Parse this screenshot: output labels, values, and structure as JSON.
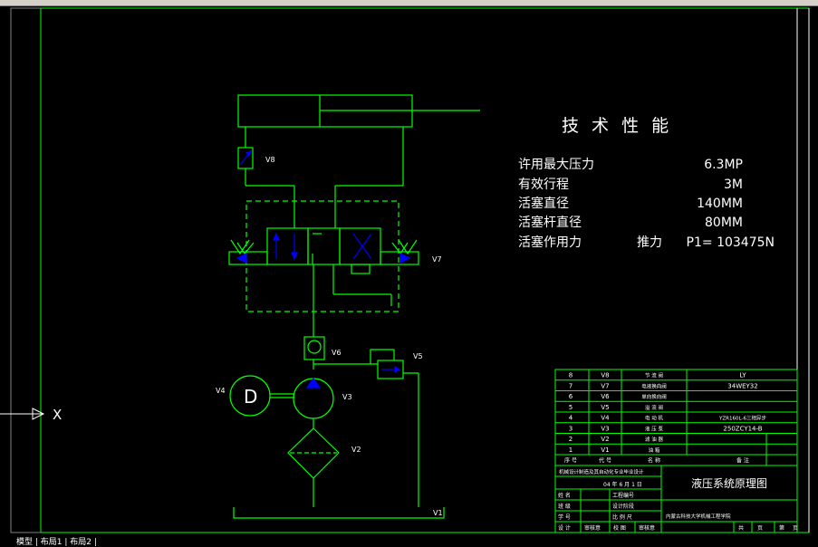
{
  "drawing": {
    "spec_title": "技 术 性 能",
    "specs": [
      {
        "label": "许用最大压力",
        "value": "6.3MP"
      },
      {
        "label": "有效行程",
        "value": "3M"
      },
      {
        "label": "活塞直径",
        "value": "140MM"
      },
      {
        "label": "活塞杆直径",
        "value": "80MM"
      },
      {
        "label": "活塞作用力",
        "extra": "推力",
        "value": "P1= 103475N"
      }
    ],
    "component_labels": {
      "v8": "V8",
      "v7": "V7",
      "v6": "V6",
      "v5": "V5",
      "v4": "V4",
      "v3": "V3",
      "v2": "V2",
      "v1": "V1",
      "motor_letter": "D",
      "ucs_axis": "X"
    },
    "bom_rows": [
      {
        "no": "8",
        "code": "V8",
        "name": "节 流 阀",
        "spec": "LY"
      },
      {
        "no": "7",
        "code": "V7",
        "name": "电液换向阀",
        "spec": "34WEY32"
      },
      {
        "no": "6",
        "code": "V6",
        "name": "单向换向阀",
        "spec": ""
      },
      {
        "no": "5",
        "code": "V5",
        "name": "溢 流 阀",
        "spec": ""
      },
      {
        "no": "4",
        "code": "V4",
        "name": "电 动 机",
        "spec": "YZR160L-6三相异步"
      },
      {
        "no": "3",
        "code": "V3",
        "name": "液 压 泵",
        "spec": "250ZCY14-B"
      },
      {
        "no": "2",
        "code": "V2",
        "name": "滤 油 器",
        "spec": ""
      },
      {
        "no": "1",
        "code": "V1",
        "name": "油 箱",
        "spec": ""
      }
    ],
    "bom_header": [
      "序 号",
      "代 号",
      "名 称",
      "备 注"
    ],
    "title_block": {
      "course": "机械设计制造及其自动化专业毕业设计",
      "date": "04 年 6 月 1 日",
      "drawing_title": "液压系统原理图",
      "school": "内蒙古科技大学机械工程学院",
      "left_rows": [
        {
          "role": "姓 名",
          "field": "工程编号"
        },
        {
          "role": "班 级",
          "field": "设计阶段"
        },
        {
          "role": "学 号",
          "field": "比 例 尺"
        }
      ],
      "bottom_row": [
        "设 计",
        "审核意",
        "校 图",
        "审核意"
      ],
      "sheet": [
        "共",
        "页",
        "第",
        "页"
      ]
    },
    "status_strip": "模型 | 布局1 | 布局2 |"
  },
  "colors": {
    "line": "#00ff00",
    "frame": "#ffffff",
    "symbol": "#0000ff",
    "text": "#ffffff",
    "table": "#00ff00"
  }
}
